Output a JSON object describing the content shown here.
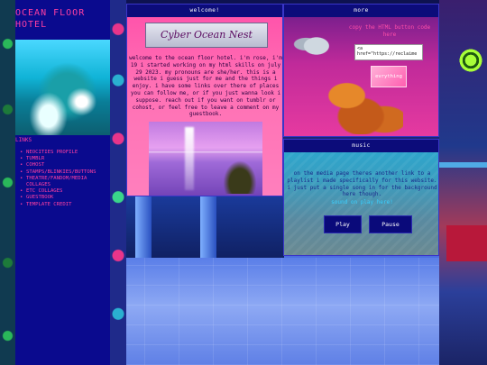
{
  "site": {
    "title": "OCEAN FLOOR\nHOTEL"
  },
  "sidebar": {
    "links_title": "LINKS",
    "links": [
      "NEOCITIES PROFILE",
      "TUMBLR",
      "COHOST",
      "STAMPS/BLINKIES/BUTTONS",
      "THEATRE/FANDOM/MEDIA COLLAGES",
      "ETC COLLAGES",
      "GUESTBOOK",
      "TEMPLATE CREDIT"
    ]
  },
  "welcome": {
    "heading": "welcome!",
    "logo_text": "Cyber Ocean Nest",
    "body": "welcome to the ocean floor hotel. i'm rose, i'm 19 i started working on my html skills on july 29 2023. my pronouns are she/her. this is a website i guess just for me and the things i enjoy. i have some links over there of places you can follow me, or if you just wanna look i suppose. reach out if you want on tumblr or cohost, or feel free to leave a comment on my guestbook."
  },
  "more": {
    "heading": "more",
    "copy_text": "copy the HTML button code here",
    "code_value": "<a href=\"https://reclaime",
    "button_label": "evrything"
  },
  "music": {
    "heading": "music",
    "text_lead": "on the media page theres another link to a playlist i made specifically for this website. i just put a single song in for the background here though.",
    "song_link": "sound on play here!",
    "play_label": "Play",
    "pause_label": "Pause"
  },
  "colors": {
    "sidebar_bg": "#0a0a8e",
    "accent_pink": "#ff3fa2",
    "panel_header": "#0c0c7a"
  }
}
